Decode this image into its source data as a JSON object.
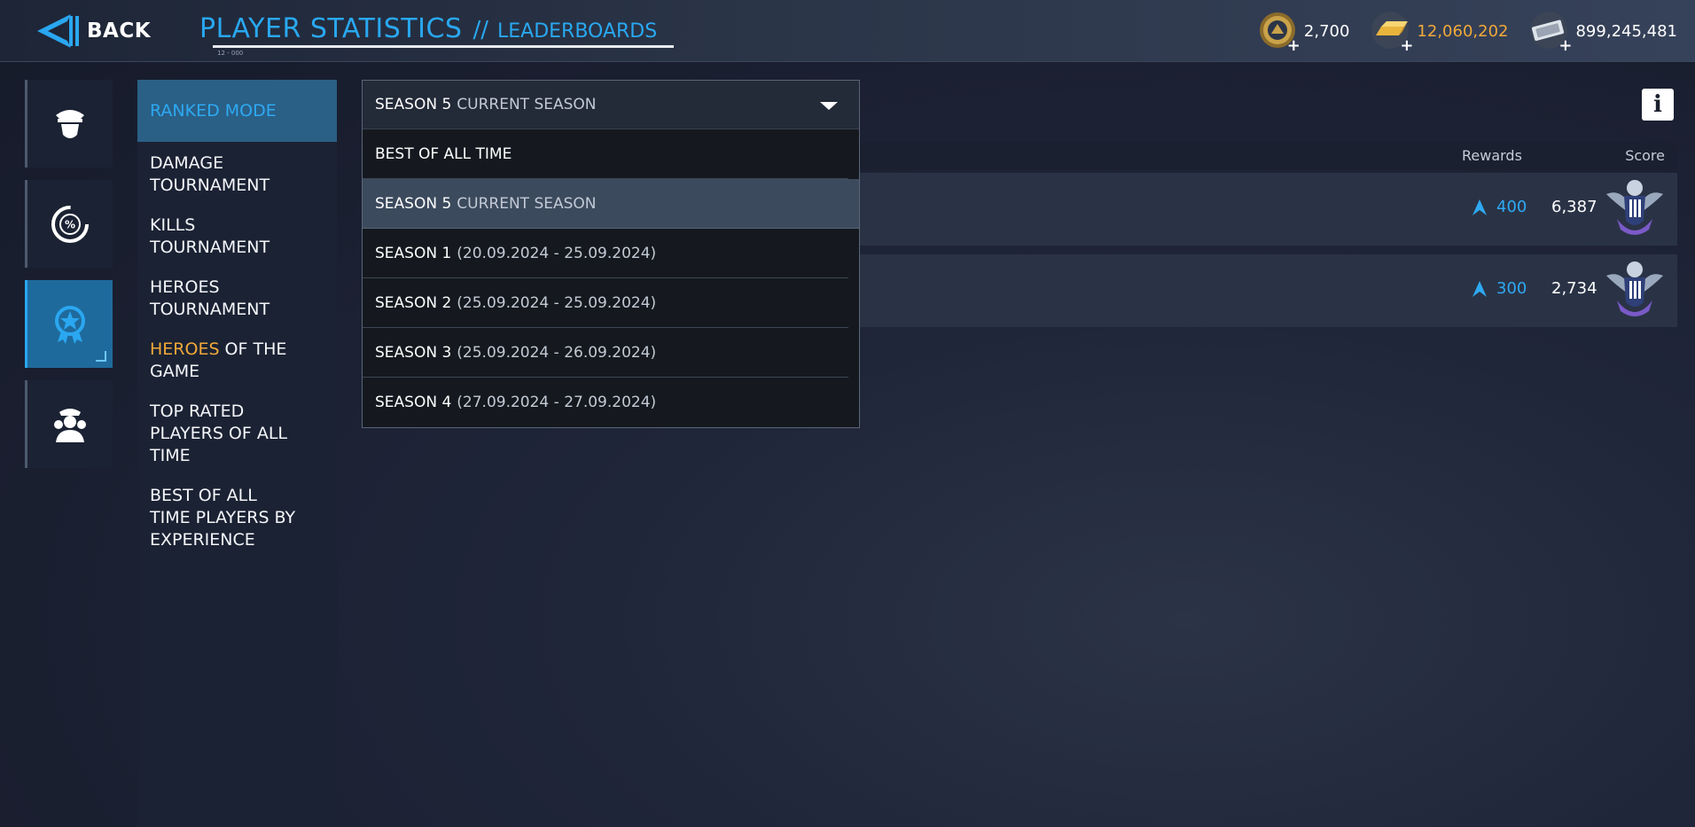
{
  "header": {
    "back_label": "BACK",
    "title": "PLAYER STATISTICS",
    "title_sep": "//",
    "subtitle": "LEADERBOARDS",
    "small_caption": "12 - 000"
  },
  "currencies": [
    {
      "name": "medal-coin",
      "value": "2,700",
      "color": "#ffffff"
    },
    {
      "name": "gold-bar",
      "value": "12,060,202",
      "color": "#f2a93a"
    },
    {
      "name": "silver-cash",
      "value": "899,245,481",
      "color": "#ffffff"
    }
  ],
  "icon_tabs": [
    {
      "name": "commander-icon",
      "active": false
    },
    {
      "name": "stats-percent-icon",
      "active": false
    },
    {
      "name": "ranked-badge-icon",
      "active": true
    },
    {
      "name": "crew-icon",
      "active": false
    }
  ],
  "modes": {
    "ranked": "RANKED MODE",
    "damage": "DAMAGE TOURNAMENT",
    "kills": "KILLS TOURNAMENT",
    "heroes": "HEROES TOURNAMENT",
    "heroes_game_hl": "HEROES",
    "heroes_game_rest": " OF THE GAME",
    "top_rated": "TOP RATED PLAYERS OF ALL TIME",
    "best_exp": "BEST OF ALL TIME PLAYERS BY EXPERIENCE"
  },
  "dropdown": {
    "selected_main": "SEASON 5",
    "selected_sub": "CURRENT SEASON",
    "options": [
      {
        "main": "BEST OF ALL TIME",
        "sub": ""
      },
      {
        "main": "SEASON 5",
        "sub": "CURRENT SEASON"
      },
      {
        "main": "SEASON 1",
        "sub": "(20.09.2024 - 25.09.2024)"
      },
      {
        "main": "SEASON 2",
        "sub": "(25.09.2024 - 25.09.2024)"
      },
      {
        "main": "SEASON 3",
        "sub": "(25.09.2024 - 26.09.2024)"
      },
      {
        "main": "SEASON 4",
        "sub": "(27.09.2024 - 27.09.2024)"
      }
    ]
  },
  "table": {
    "col_rewards": "Rewards",
    "col_score": "Score",
    "rows": [
      {
        "reward": "400",
        "score": "6,387"
      },
      {
        "reward": "300",
        "score": "2,734"
      }
    ]
  }
}
